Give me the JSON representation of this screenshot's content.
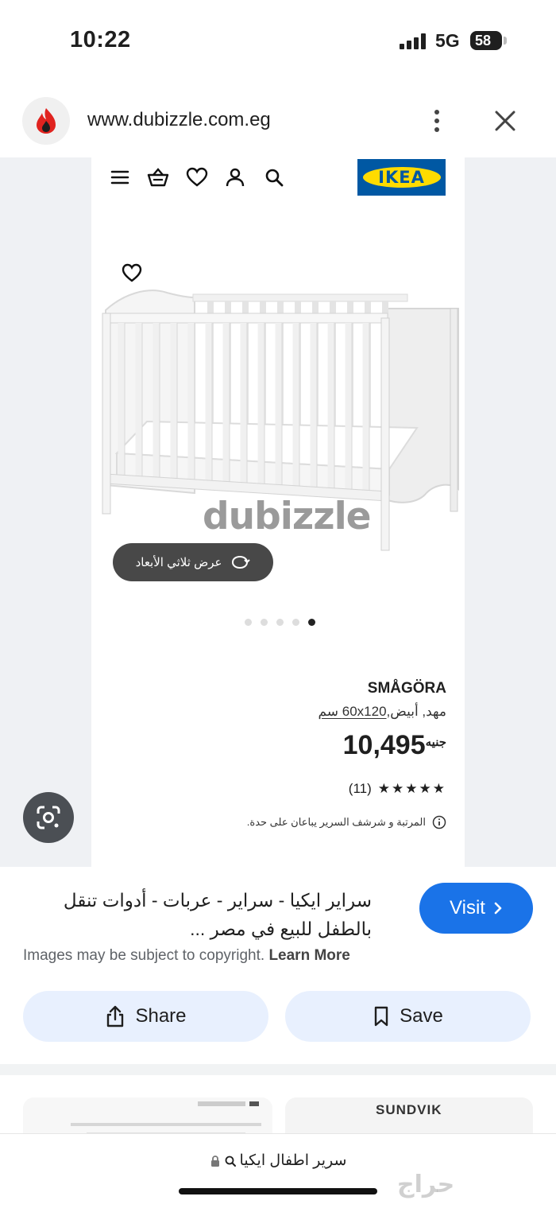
{
  "status_bar": {
    "time": "10:22",
    "network": "5G",
    "battery": "58"
  },
  "browser": {
    "url": "www.dubizzle.com.eg"
  },
  "product": {
    "brand_logo": "IKEA",
    "name": "SMÅGÖRA",
    "desc_prefix": "مهد, أبيض,",
    "desc_size": "60x120 سم",
    "price": "10,495",
    "currency": "جنيه",
    "review_count": "(11)",
    "rating_stars": 5,
    "stars_text": "★★★★★",
    "note": "المرتبة و شرشف السرير يباعان على حدة.",
    "view_3d_label": "عرض ثلاثي الأبعاد",
    "watermark": "dubizzle",
    "carousel_dots": 5,
    "carousel_active": 4
  },
  "result": {
    "title": "سراير ايكيا - سراير - عربات - أدوات تنقل بالطفل للبيع في مصر ...",
    "visit_label": "Visit",
    "copyright_text": "Images may be subject to copyright.",
    "learn_more": "Learn More",
    "share_label": "Share",
    "save_label": "Save"
  },
  "related": {
    "second_title": "SUNDVIK"
  },
  "bottom": {
    "query": "سرير اطفال ايكيا",
    "haraj_watermark": "حراج"
  },
  "icons": {
    "site": "dubizzle-flame-icon",
    "menu": "kebab-menu-icon",
    "close": "close-icon",
    "lens": "google-lens-icon"
  },
  "colors": {
    "accent": "#1a73e8",
    "ikea_blue": "#0058a3",
    "ikea_yellow": "#ffdb00",
    "pill": "#e8f0fe"
  }
}
